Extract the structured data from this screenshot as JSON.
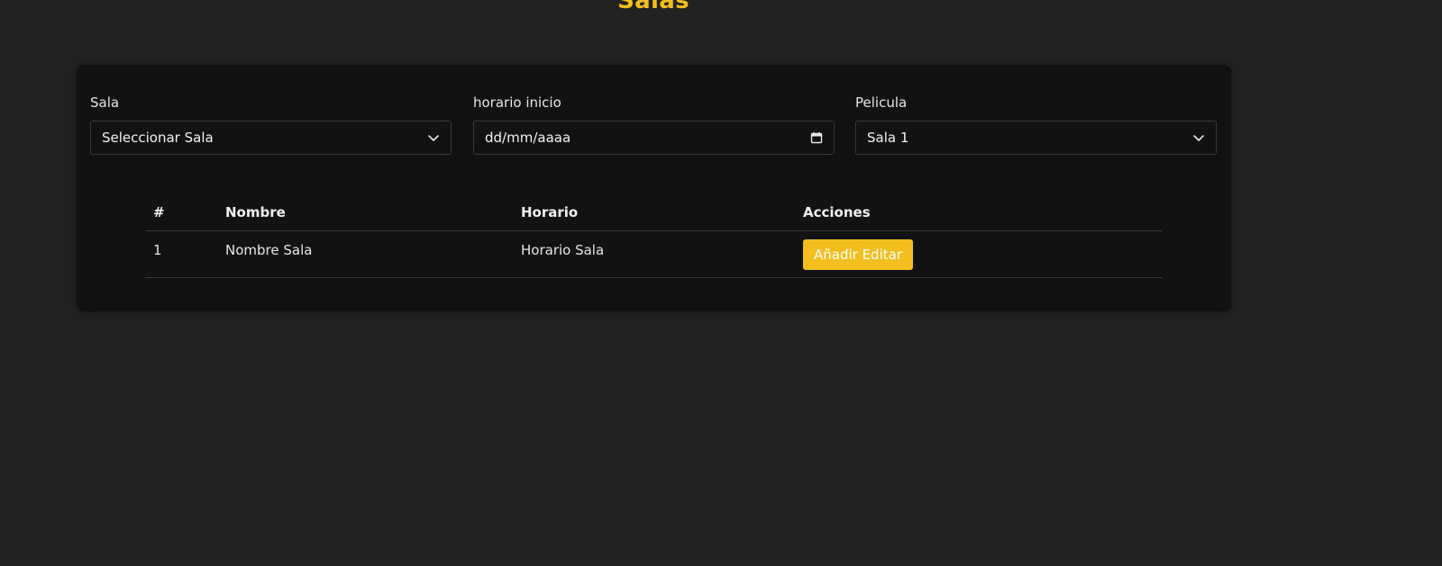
{
  "title": "Salas",
  "filters": {
    "sala": {
      "label": "Sala",
      "value": "Seleccionar Sala"
    },
    "horario": {
      "label": "horario inicio",
      "value": "dd/mm/aaaa"
    },
    "pelicula": {
      "label": "Pelicula",
      "value": "Sala 1"
    }
  },
  "table": {
    "headers": [
      "#",
      "Nombre",
      "Horario",
      "Acciones"
    ],
    "rows": [
      {
        "num": "1",
        "nombre": "Nombre Sala",
        "horario": "Horario Sala",
        "action_label": "Añadir Editar"
      }
    ]
  },
  "colors": {
    "accent": "#f3bd1b",
    "background": "#222222",
    "card": "#121212"
  },
  "icons": {
    "select": "chevron-down-icon",
    "date": "calendar-icon"
  }
}
